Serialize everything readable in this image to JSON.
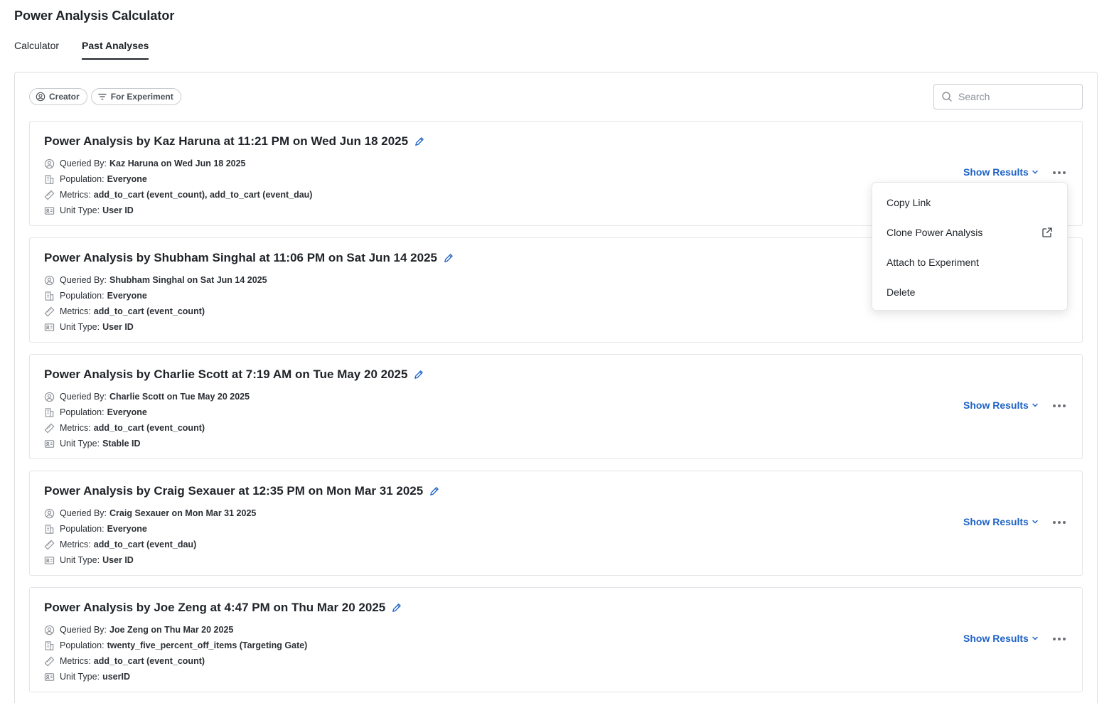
{
  "app": {
    "title": "Power Analysis Calculator"
  },
  "tabs": [
    {
      "label": "Calculator",
      "active": false
    },
    {
      "label": "Past Analyses",
      "active": true
    }
  ],
  "filters": {
    "creator": {
      "label": "Creator",
      "icon": "user-circle-icon"
    },
    "for_experiment": {
      "label": "For Experiment",
      "icon": "filter-icon"
    }
  },
  "search": {
    "placeholder": "Search",
    "value": ""
  },
  "labels": {
    "queried_by": "Queried By:",
    "population": "Population:",
    "metrics": "Metrics:",
    "unit_type": "Unit Type:",
    "show_results": "Show Results"
  },
  "analyses": [
    {
      "title": "Power Analysis by Kaz Haruna at 11:21 PM on Wed Jun 18 2025",
      "queried_by": "Kaz Haruna on Wed Jun 18 2025",
      "population": "Everyone",
      "metrics": "add_to_cart (event_count), add_to_cart (event_dau)",
      "unit_type": "User ID"
    },
    {
      "title": "Power Analysis by Shubham Singhal at 11:06 PM on Sat Jun 14 2025",
      "queried_by": "Shubham Singhal on Sat Jun 14 2025",
      "population": "Everyone",
      "metrics": "add_to_cart (event_count)",
      "unit_type": "User ID"
    },
    {
      "title": "Power Analysis by Charlie Scott at 7:19 AM on Tue May 20 2025",
      "queried_by": "Charlie Scott on Tue May 20 2025",
      "population": "Everyone",
      "metrics": "add_to_cart (event_count)",
      "unit_type": "Stable ID"
    },
    {
      "title": "Power Analysis by Craig Sexauer at 12:35 PM on Mon Mar 31 2025",
      "queried_by": "Craig Sexauer on Mon Mar 31 2025",
      "population": "Everyone",
      "metrics": "add_to_cart (event_dau)",
      "unit_type": "User ID"
    },
    {
      "title": "Power Analysis by Joe Zeng at 4:47 PM on Thu Mar 20 2025",
      "queried_by": "Joe Zeng on Thu Mar 20 2025",
      "population": "twenty_five_percent_off_items (Targeting Gate)",
      "metrics": "add_to_cart (event_count)",
      "unit_type": "userID"
    }
  ],
  "context_menu": {
    "items": [
      {
        "label": "Copy Link"
      },
      {
        "label": "Clone Power Analysis",
        "icon": "external-link-icon"
      },
      {
        "label": "Attach to Experiment"
      },
      {
        "label": "Delete"
      }
    ]
  },
  "colors": {
    "accent": "#1f63c6",
    "border": "#e2e5e9",
    "text": "#1f2328"
  }
}
